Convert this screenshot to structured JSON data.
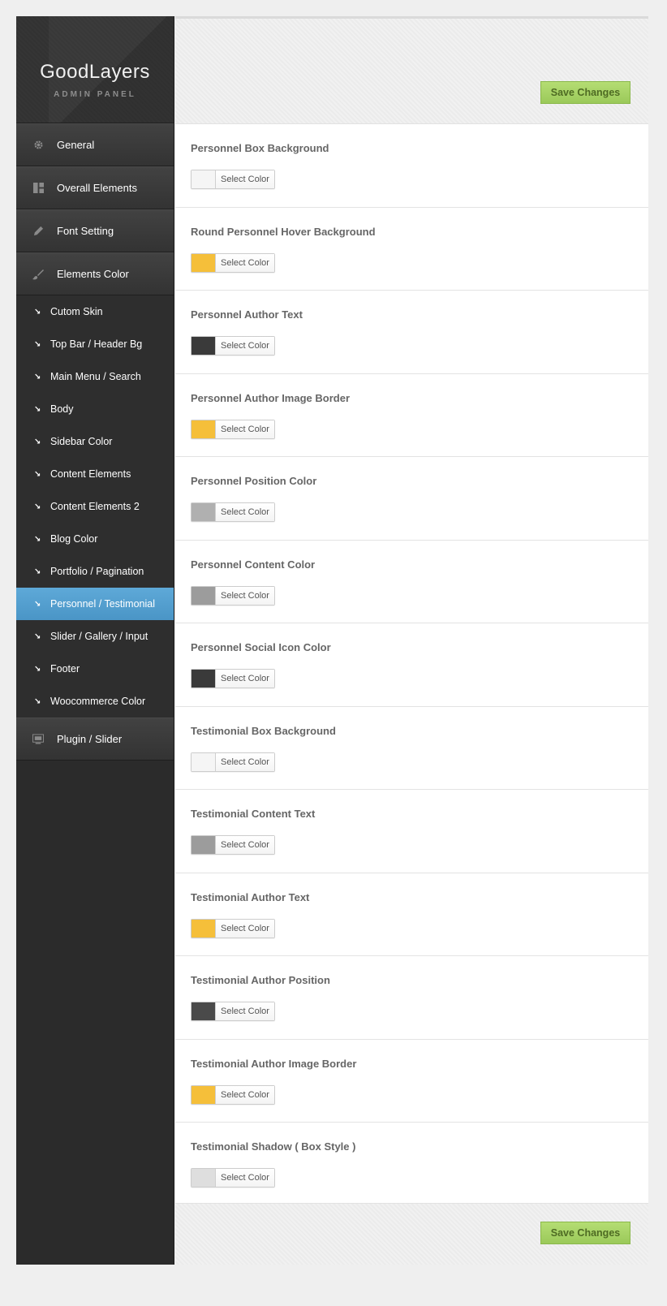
{
  "logo": {
    "title": "GoodLayers",
    "subtitle": "ADMIN PANEL"
  },
  "sidebar": {
    "main_items": [
      {
        "label": "General",
        "icon": "gear-icon"
      },
      {
        "label": "Overall Elements",
        "icon": "layout-icon"
      },
      {
        "label": "Font Setting",
        "icon": "pencil-icon"
      },
      {
        "label": "Elements Color",
        "icon": "brush-icon"
      }
    ],
    "sub_items": [
      {
        "label": "Cutom Skin"
      },
      {
        "label": "Top Bar / Header Bg"
      },
      {
        "label": "Main Menu / Search"
      },
      {
        "label": "Body"
      },
      {
        "label": "Sidebar Color"
      },
      {
        "label": "Content Elements"
      },
      {
        "label": "Content Elements 2"
      },
      {
        "label": "Blog Color"
      },
      {
        "label": "Portfolio / Pagination"
      },
      {
        "label": "Personnel / Testimonial",
        "active": true
      },
      {
        "label": "Slider / Gallery / Input"
      },
      {
        "label": "Footer"
      },
      {
        "label": "Woocommerce Color"
      }
    ],
    "bottom_item": {
      "label": "Plugin / Slider",
      "icon": "slider-icon"
    }
  },
  "toolbar": {
    "save_label": "Save Changes"
  },
  "picker_label": "Select Color",
  "settings": [
    {
      "label": "Personnel Box Background",
      "color": "#f5f5f5"
    },
    {
      "label": "Round Personnel Hover Background",
      "color": "#f5bf3a"
    },
    {
      "label": "Personnel Author Text",
      "color": "#3a3a3a"
    },
    {
      "label": "Personnel Author Image Border",
      "color": "#f5bf3a"
    },
    {
      "label": "Personnel Position Color",
      "color": "#b0b0b0"
    },
    {
      "label": "Personnel Content Color",
      "color": "#9c9c9c"
    },
    {
      "label": "Personnel Social Icon Color",
      "color": "#3a3a3a"
    },
    {
      "label": "Testimonial Box Background",
      "color": "#f5f5f5"
    },
    {
      "label": "Testimonial Content Text",
      "color": "#9c9c9c"
    },
    {
      "label": "Testimonial Author Text",
      "color": "#f5bf3a"
    },
    {
      "label": "Testimonial Author Position",
      "color": "#4a4a4a"
    },
    {
      "label": "Testimonial Author Image Border",
      "color": "#f5bf3a"
    },
    {
      "label": "Testimonial Shadow ( Box Style )",
      "color": "#dedede"
    }
  ]
}
